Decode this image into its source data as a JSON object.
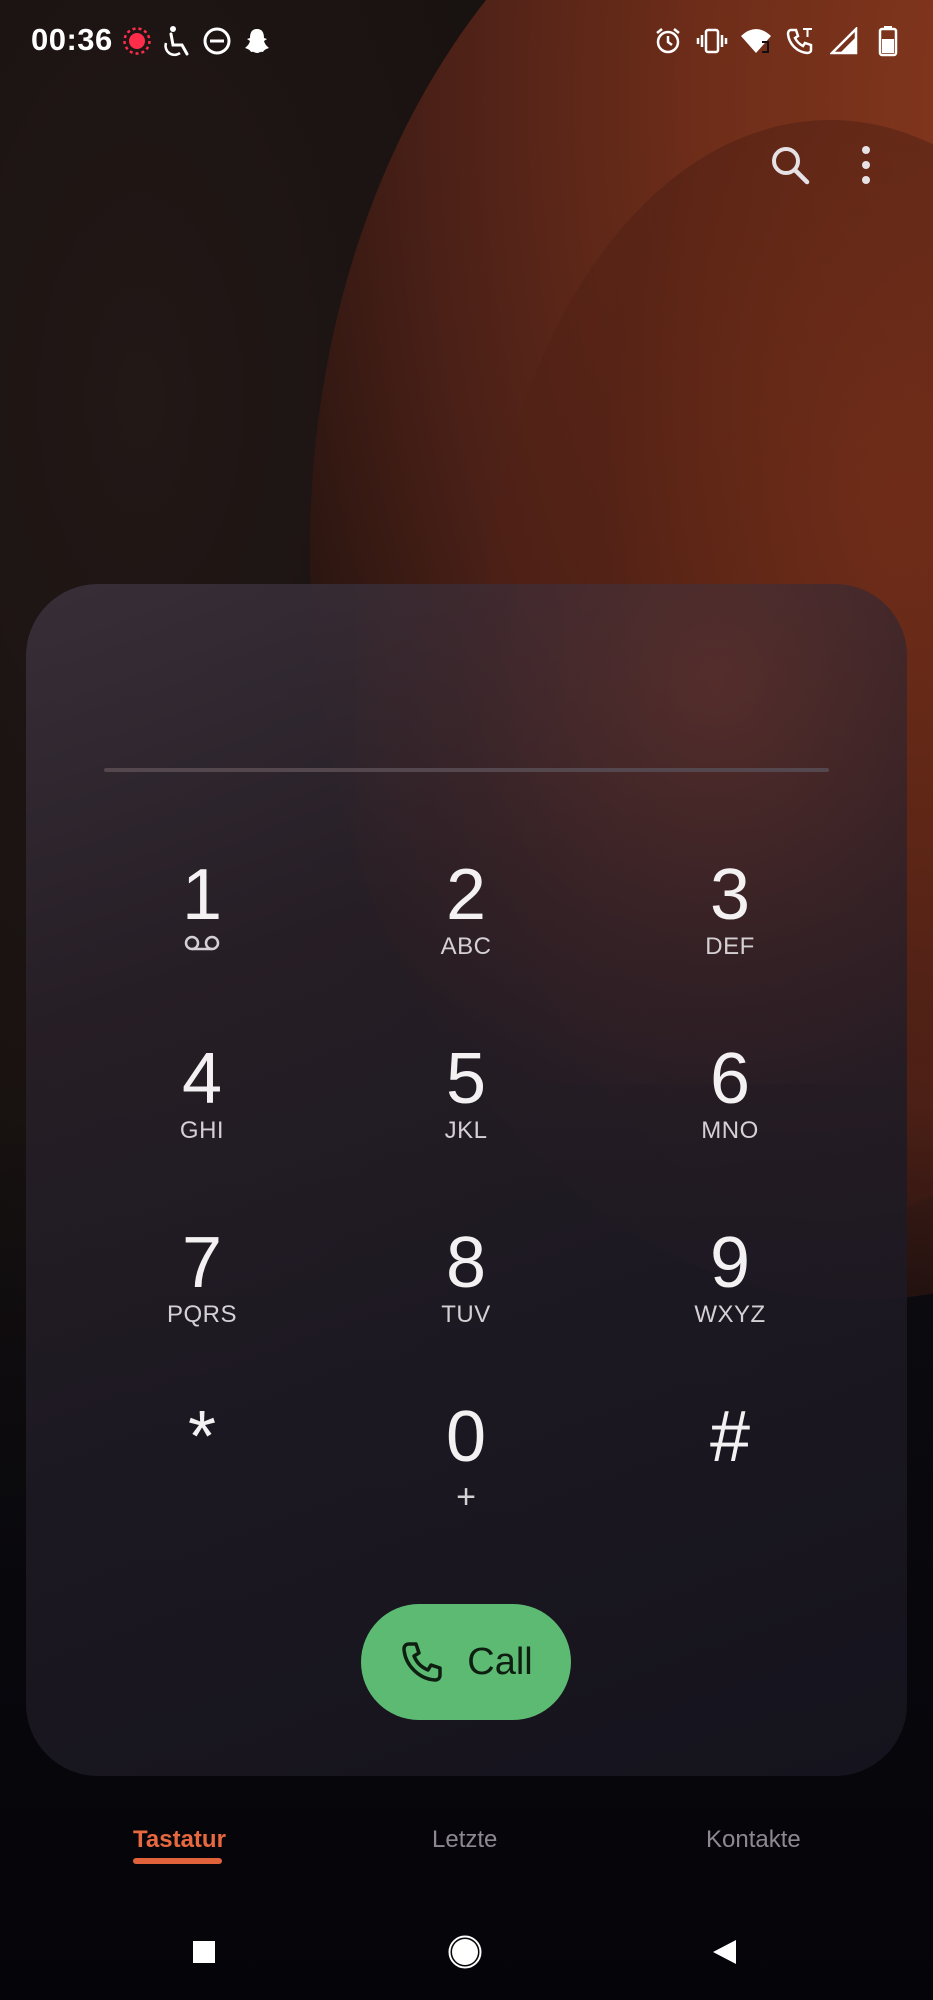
{
  "status_bar": {
    "time": "00:36",
    "left_icons": [
      "recording-dot-icon",
      "accessibility-icon",
      "do-not-disturb-icon",
      "snapchat-icon"
    ],
    "right_icons": [
      "alarm-icon",
      "vibrate-icon",
      "wifi-calling-icon",
      "wifi-call-icon",
      "signal-icon",
      "battery-icon"
    ]
  },
  "toolbar": {
    "search_icon": "search-icon",
    "menu_icon": "more-vert-icon"
  },
  "dialpad": {
    "keys": [
      {
        "digit": "1",
        "letters": "",
        "sub_icon": "voicemail-icon"
      },
      {
        "digit": "2",
        "letters": "ABC"
      },
      {
        "digit": "3",
        "letters": "DEF"
      },
      {
        "digit": "4",
        "letters": "GHI"
      },
      {
        "digit": "5",
        "letters": "JKL"
      },
      {
        "digit": "6",
        "letters": "MNO"
      },
      {
        "digit": "7",
        "letters": "PQRS"
      },
      {
        "digit": "8",
        "letters": "TUV"
      },
      {
        "digit": "9",
        "letters": "WXYZ"
      },
      {
        "digit": "*",
        "letters": ""
      },
      {
        "digit": "0",
        "letters": "+"
      },
      {
        "digit": "#",
        "letters": ""
      }
    ],
    "call_label": "Call"
  },
  "tabs": [
    {
      "label": "Tastatur",
      "active": true
    },
    {
      "label": "Letzte",
      "active": false
    },
    {
      "label": "Kontakte",
      "active": false
    }
  ],
  "colors": {
    "accent": "#e8683f",
    "call_green": "#5dba72"
  }
}
